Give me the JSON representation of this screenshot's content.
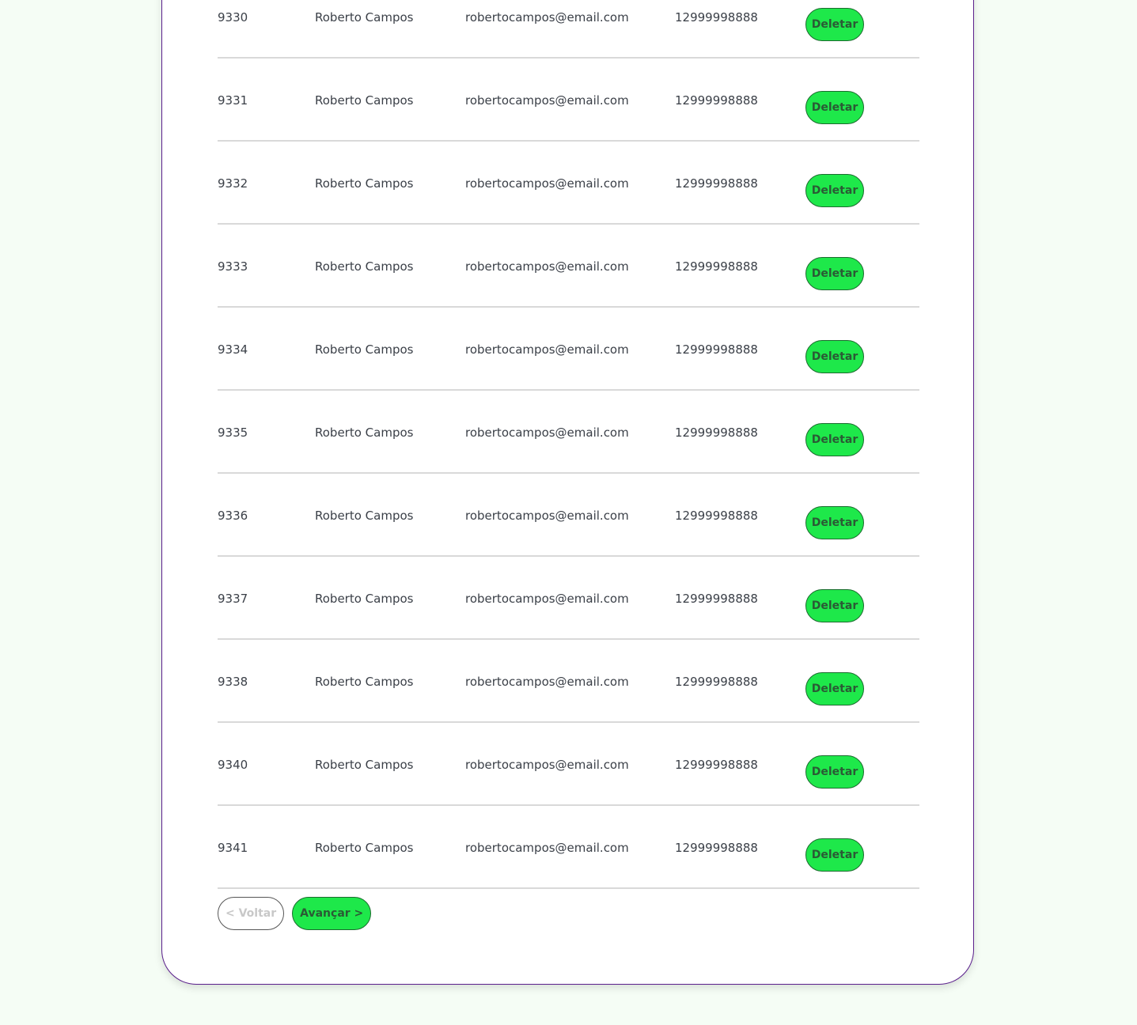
{
  "table": {
    "rows": [
      {
        "id": "9330",
        "name": "Roberto Campos",
        "email": "robertocampos@email.com",
        "phone": "12999998888",
        "action": "Deletar"
      },
      {
        "id": "9331",
        "name": "Roberto Campos",
        "email": "robertocampos@email.com",
        "phone": "12999998888",
        "action": "Deletar"
      },
      {
        "id": "9332",
        "name": "Roberto Campos",
        "email": "robertocampos@email.com",
        "phone": "12999998888",
        "action": "Deletar"
      },
      {
        "id": "9333",
        "name": "Roberto Campos",
        "email": "robertocampos@email.com",
        "phone": "12999998888",
        "action": "Deletar"
      },
      {
        "id": "9334",
        "name": "Roberto Campos",
        "email": "robertocampos@email.com",
        "phone": "12999998888",
        "action": "Deletar"
      },
      {
        "id": "9335",
        "name": "Roberto Campos",
        "email": "robertocampos@email.com",
        "phone": "12999998888",
        "action": "Deletar"
      },
      {
        "id": "9336",
        "name": "Roberto Campos",
        "email": "robertocampos@email.com",
        "phone": "12999998888",
        "action": "Deletar"
      },
      {
        "id": "9337",
        "name": "Roberto Campos",
        "email": "robertocampos@email.com",
        "phone": "12999998888",
        "action": "Deletar"
      },
      {
        "id": "9338",
        "name": "Roberto Campos",
        "email": "robertocampos@email.com",
        "phone": "12999998888",
        "action": "Deletar"
      },
      {
        "id": "9340",
        "name": "Roberto Campos",
        "email": "robertocampos@email.com",
        "phone": "12999998888",
        "action": "Deletar"
      },
      {
        "id": "9341",
        "name": "Roberto Campos",
        "email": "robertocampos@email.com",
        "phone": "12999998888",
        "action": "Deletar"
      }
    ]
  },
  "pagination": {
    "prev_label": "< Voltar",
    "prev_disabled": true,
    "next_label": "Avançar >"
  },
  "colors": {
    "accent_green": "#1ee84a",
    "card_border": "#5a1f8c",
    "page_background": "#f5fdf5"
  }
}
